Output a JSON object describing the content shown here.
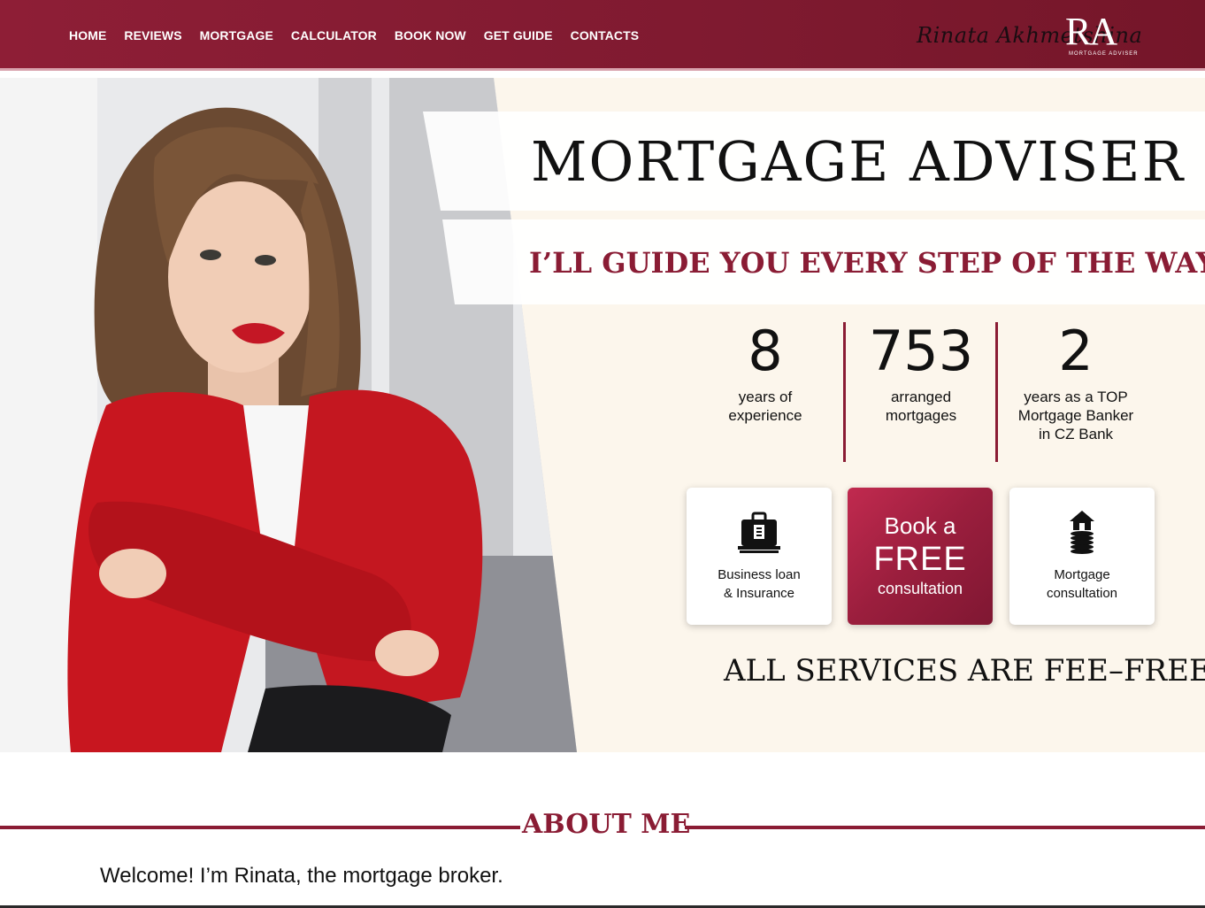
{
  "nav": {
    "links": [
      "HOME",
      "REVIEWS",
      "MORTGAGE",
      "CALCULATOR",
      "BOOK NOW",
      "GET GUIDE",
      "CONTACTS"
    ],
    "logo": {
      "script": "Rinata Akhmetshina",
      "monogram": "RA",
      "sub": "MORTGAGE ADVISER"
    }
  },
  "hero": {
    "title": "MORTGAGE ADVISER",
    "subtitle": "I’LL GUIDE YOU EVERY STEP OF THE WAY",
    "photo_icon": "adviser-portrait",
    "stats": [
      {
        "number": "8",
        "label": "years of experience"
      },
      {
        "number": "753",
        "label": "arranged mortgages"
      },
      {
        "number": "2",
        "label": "years as a TOP Mortgage Banker in CZ Bank"
      }
    ],
    "cards": {
      "business": {
        "icon": "briefcase-money-icon",
        "line1": "Business loan",
        "line2": "& Insurance"
      },
      "book": {
        "line1": "Book a",
        "line2": "FREE",
        "line3": "consultation"
      },
      "mortgage": {
        "icon": "house-coins-icon",
        "line1": "Mortgage",
        "line2": "consultation"
      }
    },
    "fee_note": "ALL SERVICES ARE FEE–FREE!"
  },
  "about": {
    "title": "ABOUT ME",
    "welcome": "Welcome! I’m Rinata, the mortgage broker."
  },
  "colors": {
    "brand": "#8a1c34",
    "nav_bg": "#7f1a30",
    "hero_bg": "#fcf6ec"
  }
}
